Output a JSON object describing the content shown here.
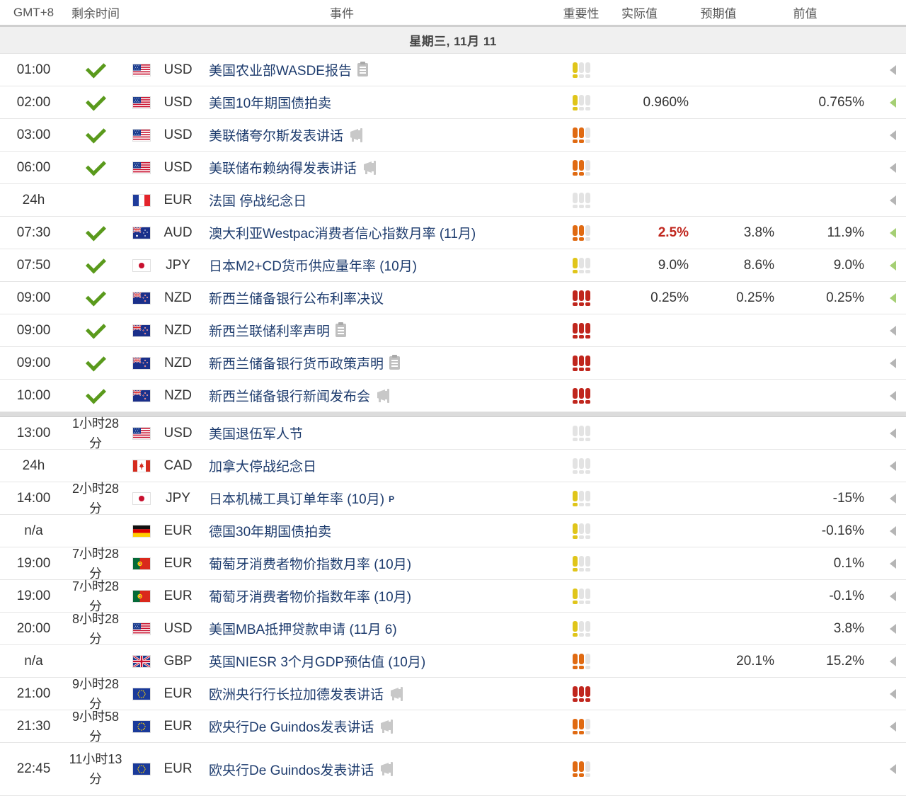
{
  "header": {
    "time": "GMT+8",
    "remaining": "剩余时间",
    "event": "事件",
    "importance": "重要性",
    "actual": "实际值",
    "forecast": "预期值",
    "previous": "前值"
  },
  "day_label": "星期三, 11月 11",
  "colors": {
    "high": "#c0261d",
    "medium": "#e06a12",
    "low": "#e0c51a",
    "off": "#e3e3e3",
    "link": "#1e3c6e",
    "check": "#5a9a1c"
  },
  "section_past": [
    {
      "time": "01:00",
      "remaining": "",
      "done": true,
      "flag": "us",
      "cur": "USD",
      "event": "美国农业部WASDE报告",
      "icon": "document-icon",
      "imp": 1,
      "actual": "",
      "actual_red": false,
      "forecast": "",
      "previous": "",
      "arrow": "gray"
    },
    {
      "time": "02:00",
      "remaining": "",
      "done": true,
      "flag": "us",
      "cur": "USD",
      "event": "美国10年期国债拍卖",
      "icon": "",
      "imp": 1,
      "actual": "0.960%",
      "actual_red": false,
      "forecast": "",
      "previous": "0.765%",
      "arrow": "green"
    },
    {
      "time": "03:00",
      "remaining": "",
      "done": true,
      "flag": "us",
      "cur": "USD",
      "event": "美联储夸尔斯发表讲话",
      "icon": "speech-icon",
      "imp": 2,
      "actual": "",
      "actual_red": false,
      "forecast": "",
      "previous": "",
      "arrow": "gray"
    },
    {
      "time": "06:00",
      "remaining": "",
      "done": true,
      "flag": "us",
      "cur": "USD",
      "event": "美联储布赖纳得发表讲话",
      "icon": "speech-icon",
      "imp": 2,
      "actual": "",
      "actual_red": false,
      "forecast": "",
      "previous": "",
      "arrow": "gray"
    },
    {
      "time": "24h",
      "remaining": "",
      "done": false,
      "flag": "fr",
      "cur": "EUR",
      "event": "法国 停战纪念日",
      "icon": "",
      "imp": 0,
      "actual": "",
      "actual_red": false,
      "forecast": "",
      "previous": "",
      "arrow": "gray"
    },
    {
      "time": "07:30",
      "remaining": "",
      "done": true,
      "flag": "au",
      "cur": "AUD",
      "event": "澳大利亚Westpac消费者信心指数月率 (11月)",
      "icon": "",
      "imp": 2,
      "actual": "2.5%",
      "actual_red": true,
      "forecast": "3.8%",
      "previous": "11.9%",
      "arrow": "green"
    },
    {
      "time": "07:50",
      "remaining": "",
      "done": true,
      "flag": "jp",
      "cur": "JPY",
      "event": "日本M2+CD货币供应量年率 (10月)",
      "icon": "",
      "imp": 1,
      "actual": "9.0%",
      "actual_red": false,
      "forecast": "8.6%",
      "previous": "9.0%",
      "arrow": "green"
    },
    {
      "time": "09:00",
      "remaining": "",
      "done": true,
      "flag": "nz",
      "cur": "NZD",
      "event": "新西兰储备银行公布利率决议",
      "icon": "",
      "imp": 3,
      "actual": "0.25%",
      "actual_red": false,
      "forecast": "0.25%",
      "previous": "0.25%",
      "arrow": "green"
    },
    {
      "time": "09:00",
      "remaining": "",
      "done": true,
      "flag": "nz",
      "cur": "NZD",
      "event": "新西兰联储利率声明",
      "icon": "document-icon",
      "imp": 3,
      "actual": "",
      "actual_red": false,
      "forecast": "",
      "previous": "",
      "arrow": "gray"
    },
    {
      "time": "09:00",
      "remaining": "",
      "done": true,
      "flag": "nz",
      "cur": "NZD",
      "event": "新西兰储备银行货币政策声明",
      "icon": "document-icon",
      "imp": 3,
      "actual": "",
      "actual_red": false,
      "forecast": "",
      "previous": "",
      "arrow": "gray"
    },
    {
      "time": "10:00",
      "remaining": "",
      "done": true,
      "flag": "nz",
      "cur": "NZD",
      "event": "新西兰储备银行新闻发布会",
      "icon": "speech-icon",
      "imp": 3,
      "actual": "",
      "actual_red": false,
      "forecast": "",
      "previous": "",
      "arrow": "gray"
    }
  ],
  "section_future": [
    {
      "time": "13:00",
      "remaining": "1小时28分",
      "done": false,
      "flag": "us",
      "cur": "USD",
      "event": "美国退伍军人节",
      "icon": "",
      "imp": 0,
      "actual": "",
      "actual_red": false,
      "forecast": "",
      "previous": "",
      "arrow": "gray"
    },
    {
      "time": "24h",
      "remaining": "",
      "done": false,
      "flag": "ca",
      "cur": "CAD",
      "event": "加拿大停战纪念日",
      "icon": "",
      "imp": 0,
      "actual": "",
      "actual_red": false,
      "forecast": "",
      "previous": "",
      "arrow": "gray"
    },
    {
      "time": "14:00",
      "remaining": "2小时28分",
      "done": false,
      "flag": "jp",
      "cur": "JPY",
      "event": "日本机械工具订单年率 (10月)",
      "icon": "preliminary-icon",
      "icon_text": "P",
      "imp": 1,
      "actual": "",
      "actual_red": false,
      "forecast": "",
      "previous": "-15%",
      "arrow": "gray"
    },
    {
      "time": "n/a",
      "remaining": "",
      "done": false,
      "flag": "de",
      "cur": "EUR",
      "event": "德国30年期国债拍卖",
      "icon": "",
      "imp": 1,
      "actual": "",
      "actual_red": false,
      "forecast": "",
      "previous": "-0.16%",
      "arrow": "gray"
    },
    {
      "time": "19:00",
      "remaining": "7小时28分",
      "done": false,
      "flag": "pt",
      "cur": "EUR",
      "event": "葡萄牙消费者物价指数月率 (10月)",
      "icon": "",
      "imp": 1,
      "actual": "",
      "actual_red": false,
      "forecast": "",
      "previous": "0.1%",
      "arrow": "gray"
    },
    {
      "time": "19:00",
      "remaining": "7小时28分",
      "done": false,
      "flag": "pt",
      "cur": "EUR",
      "event": "葡萄牙消费者物价指数年率 (10月)",
      "icon": "",
      "imp": 1,
      "actual": "",
      "actual_red": false,
      "forecast": "",
      "previous": "-0.1%",
      "arrow": "gray"
    },
    {
      "time": "20:00",
      "remaining": "8小时28分",
      "done": false,
      "flag": "us",
      "cur": "USD",
      "event": "美国MBA抵押贷款申请 (11月 6)",
      "icon": "",
      "imp": 1,
      "actual": "",
      "actual_red": false,
      "forecast": "",
      "previous": "3.8%",
      "arrow": "gray"
    },
    {
      "time": "n/a",
      "remaining": "",
      "done": false,
      "flag": "gb",
      "cur": "GBP",
      "event": "英国NIESR 3个月GDP预估值 (10月)",
      "icon": "",
      "imp": 2,
      "actual": "",
      "actual_red": false,
      "forecast": "20.1%",
      "previous": "15.2%",
      "arrow": "gray"
    },
    {
      "time": "21:00",
      "remaining": "9小时28分",
      "done": false,
      "flag": "eu",
      "cur": "EUR",
      "event": "欧洲央行行长拉加德发表讲话",
      "icon": "speech-icon",
      "imp": 3,
      "actual": "",
      "actual_red": false,
      "forecast": "",
      "previous": "",
      "arrow": "gray"
    },
    {
      "time": "21:30",
      "remaining": "9小时58分",
      "done": false,
      "flag": "eu",
      "cur": "EUR",
      "event": "欧央行De Guindos发表讲话",
      "icon": "speech-icon",
      "imp": 2,
      "actual": "",
      "actual_red": false,
      "forecast": "",
      "previous": "",
      "arrow": "gray"
    },
    {
      "time": "22:45",
      "remaining": "11小时13分",
      "done": false,
      "flag": "eu",
      "cur": "EUR",
      "event": "欧央行De Guindos发表讲话",
      "icon": "speech-icon",
      "imp": 2,
      "actual": "",
      "actual_red": false,
      "forecast": "",
      "previous": "",
      "arrow": "gray",
      "tall": true
    }
  ]
}
